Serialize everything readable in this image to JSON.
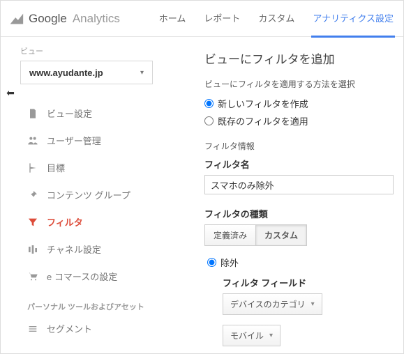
{
  "header": {
    "brand_google": "Google",
    "brand_analytics": "Analytics",
    "nav": {
      "home": "ホーム",
      "report": "レポート",
      "custom": "カスタム",
      "admin": "アナリティクス設定"
    }
  },
  "sidebar": {
    "view_label": "ビュー",
    "domain": "www.ayudante.jp",
    "items": {
      "view_settings": "ビュー設定",
      "user_management": "ユーザー管理",
      "goals": "目標",
      "content_groups": "コンテンツ グループ",
      "filters": "フィルタ",
      "channel_settings": "チャネル設定",
      "ecommerce_settings": "e コマースの設定"
    },
    "group_label": "パーソナル ツールおよびアセット",
    "segments": "セグメント"
  },
  "main": {
    "title": "ビューにフィルタを追加",
    "apply_method_label": "ビューにフィルタを適用する方法を選択",
    "radio_new": "新しいフィルタを作成",
    "radio_existing": "既存のフィルタを適用",
    "filter_info_label": "フィルタ情報",
    "filter_name_label": "フィルタ名",
    "filter_name_value": "スマホのみ除外",
    "filter_type_label": "フィルタの種類",
    "tab_predefined": "定義済み",
    "tab_custom": "カスタム",
    "radio_exclude": "除外",
    "filter_field_label": "フィルタ フィールド",
    "device_category": "デバイスのカテゴリ",
    "mobile": "モバイル"
  }
}
